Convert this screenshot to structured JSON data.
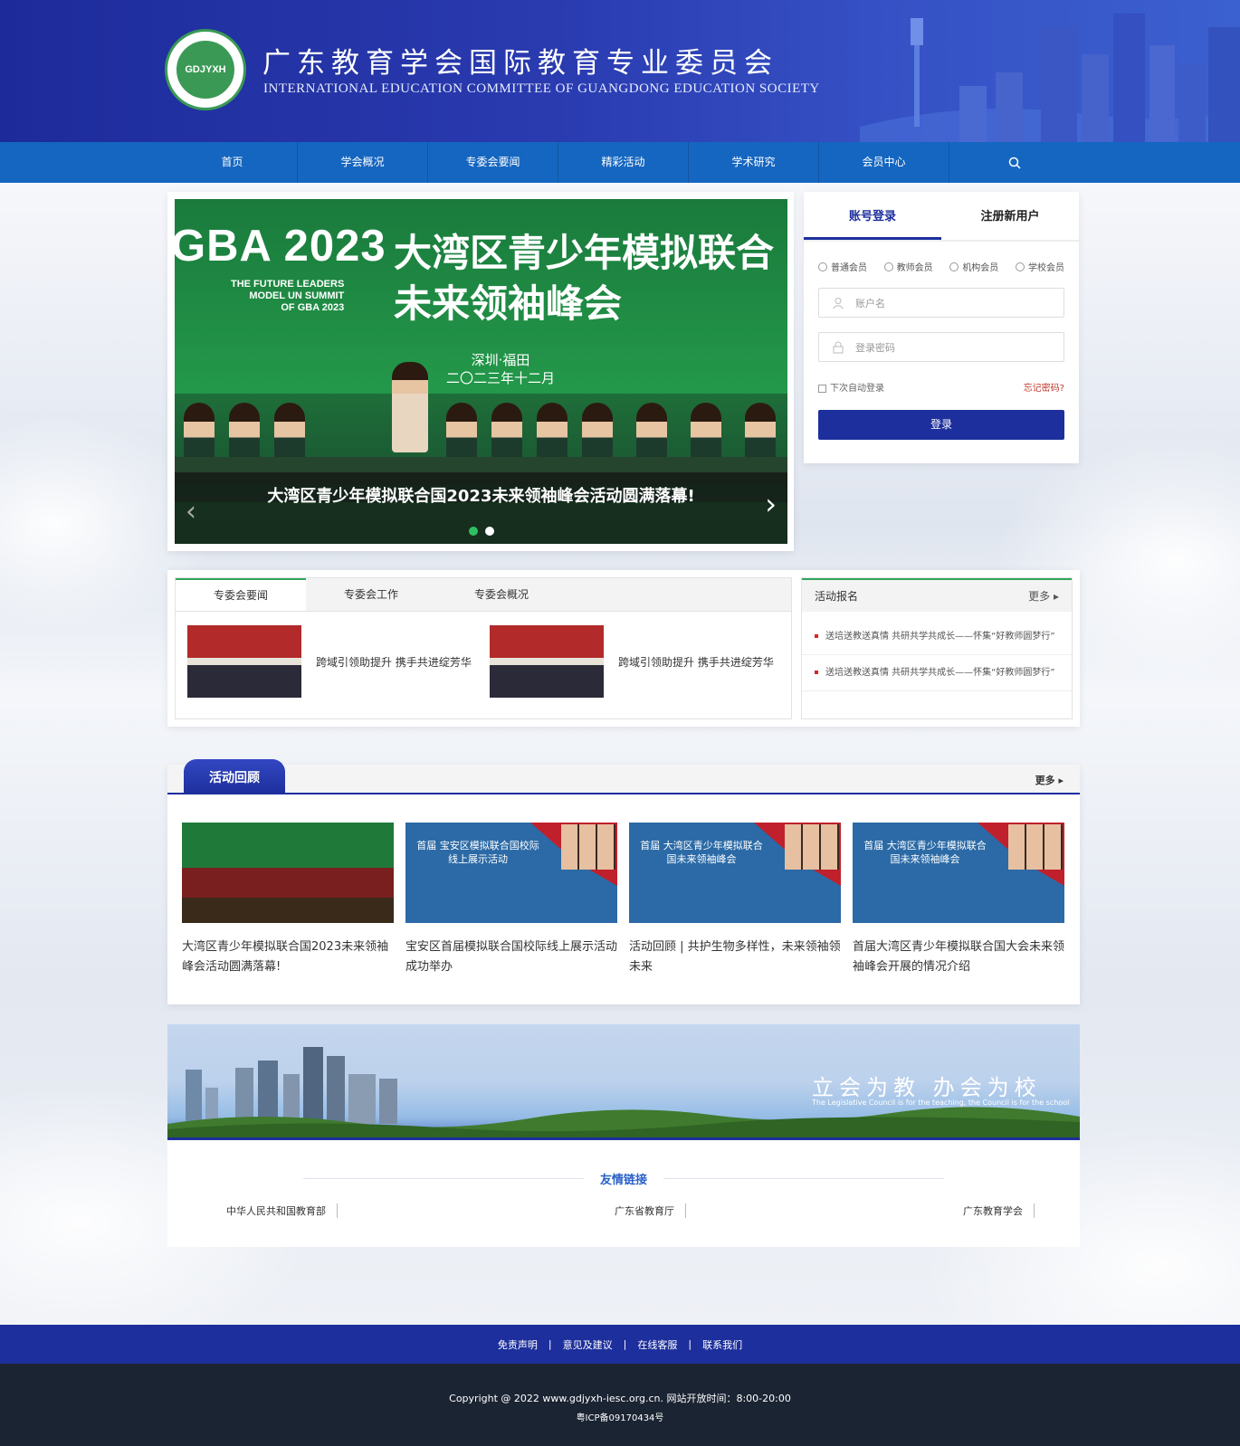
{
  "header": {
    "logo_text": "GDJYXH",
    "title": "广东教育学会国际教育专业委员会",
    "subtitle": "INTERNATIONAL EDUCATION COMMITTEE OF GUANGDONG EDUCATION SOCIETY"
  },
  "nav": {
    "items": [
      "首页",
      "学会概况",
      "专委会要闻",
      "精彩活动",
      "学术研究",
      "会员中心"
    ],
    "search_icon": "search-icon"
  },
  "banner": {
    "headline_en": "GBA 2023",
    "summit_en": [
      "THE FUTURE LEADERS",
      "MODEL UN SUMMIT",
      "OF GBA 2023"
    ],
    "headline_cn_1": "大湾区青少年模拟联合",
    "headline_cn_2": "未来领袖峰会",
    "location_1": "深圳·福田",
    "location_2": "二〇二三年十二月",
    "caption": "大湾区青少年模拟联合国2023未来领袖峰会活动圆满落幕!",
    "active_slide": 1,
    "slide_count": 2
  },
  "login": {
    "tab_login": "账号登录",
    "tab_register": "注册新用户",
    "member_types": [
      "普通会员",
      "教师会员",
      "机构会员",
      "学校会员"
    ],
    "username_placeholder": "账户名",
    "password_placeholder": "登录密码",
    "remember": "下次自动登录",
    "forgot": "忘记密码?",
    "submit": "登录"
  },
  "news": {
    "tabs": [
      "专委会要闻",
      "专委会工作",
      "专委会概况"
    ],
    "items": [
      {
        "title": "跨域引领助提升 携手共进绽芳华"
      },
      {
        "title": "跨域引领助提升 携手共进绽芳华"
      }
    ]
  },
  "activity": {
    "title": "活动报名",
    "more": "更多",
    "items": [
      "送培送教送真情 共研共学共成长——怀集“好教师圆梦行”",
      "送培送教送真情 共研共学共成长——怀集“好教师圆梦行”"
    ]
  },
  "review": {
    "title": "活动回顾",
    "more": "更多",
    "cards": [
      {
        "caption": "大湾区青少年模拟联合国2023未来领袖峰会活动圆满落幕!",
        "image_text": ""
      },
      {
        "caption": "宝安区首届模拟联合国校际线上展示活动成功举办",
        "image_text": "首届 宝安区模拟联合国校际线上展示活动"
      },
      {
        "caption": "活动回顾 | 共护生物多样性，未来领袖领未来",
        "image_text": "首届 大湾区青少年模拟联合国未来领袖峰会"
      },
      {
        "caption": "首届大湾区青少年模拟联合国大会未来领袖峰会开展的情况介绍",
        "image_text": "首届 大湾区青少年模拟联合国未来领袖峰会"
      }
    ]
  },
  "band": {
    "slogan": "立会为教 办会为校",
    "slogan_en": "The Legislative Council is for the teaching, the Council is for the school"
  },
  "friends": {
    "title": "友情链接",
    "links": [
      "中华人民共和国教育部",
      "广东省教育厅",
      "广东教育学会"
    ]
  },
  "footer": {
    "links": [
      "免责声明",
      "意见及建议",
      "在线客服",
      "联系我们"
    ],
    "copyright": "Copyright @ 2022 www.gdjyxh-iesc.org.cn. 网站开放时间：8:00-20:00",
    "icp": "粤ICP备09170434号"
  },
  "colors": {
    "primary": "#1d2f9c",
    "nav": "#1566c0",
    "accent_green": "#2fa65c",
    "footer_dark": "#1b2433"
  }
}
